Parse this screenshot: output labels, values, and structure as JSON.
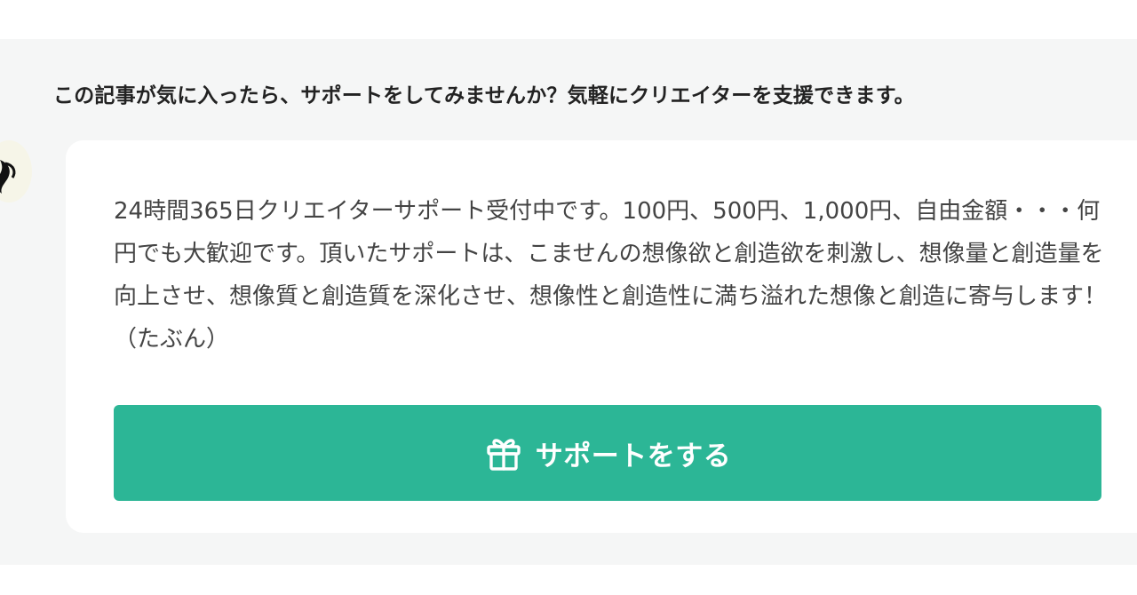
{
  "support": {
    "heading": "この記事が気に入ったら、サポートをしてみませんか？気軽にクリエイターを支援できます。",
    "message": "24時間365日クリエイターサポート受付中です。100円、500円、1,000円、自由金額・・・何円でも大歓迎です。頂いたサポートは、こませんの想像欲と創造欲を刺激し、想像量と創造量を向上させ、想像質と創造質を深化させ、想像性と創造性に満ち溢れた想像と創造に寄与します！（たぶん）",
    "button_label": "サポートをする",
    "button_icon": "gift-icon"
  },
  "colors": {
    "section_background": "#f5f6f6",
    "card_background": "#ffffff",
    "accent": "#2cb696",
    "heading_text": "#222222",
    "body_text": "#444444"
  }
}
